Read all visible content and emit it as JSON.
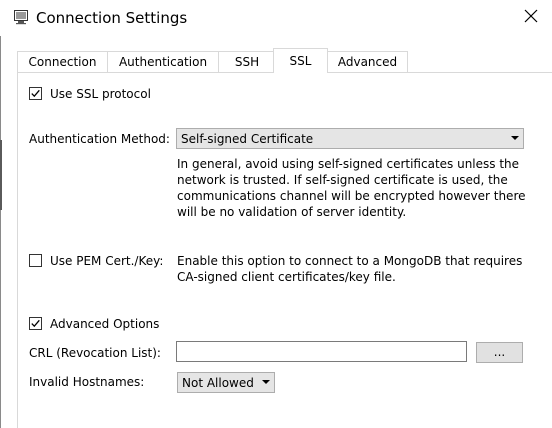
{
  "window": {
    "title": "Connection Settings"
  },
  "tabs": [
    {
      "label": "Connection"
    },
    {
      "label": "Authentication"
    },
    {
      "label": "SSH"
    },
    {
      "label": "SSL",
      "active": true
    },
    {
      "label": "Advanced"
    }
  ],
  "ssl": {
    "use_ssl": {
      "label": "Use SSL protocol",
      "checked": true
    },
    "auth_method": {
      "label": "Authentication Method:",
      "selected": "Self-signed Certificate",
      "description": "In general, avoid using self-signed certificates unless the network is trusted. If self-signed certificate is used, the communications channel will be encrypted however there will be no validation of server identity."
    },
    "use_pem": {
      "label": "Use PEM Cert./Key:",
      "checked": false,
      "description": "Enable this option to connect to a MongoDB that requires CA-signed client certificates/key file."
    },
    "advanced_options": {
      "label": "Advanced Options",
      "checked": true
    },
    "crl": {
      "label": "CRL (Revocation List):",
      "value": "",
      "browse_label": "..."
    },
    "invalid_hostnames": {
      "label": "Invalid Hostnames:",
      "selected": "Not Allowed"
    }
  },
  "colors": {
    "tab_border": "#d9d9d9",
    "combo_bg": "#e5e5e5",
    "button_bg": "#e1e1e1"
  },
  "icons": {
    "app": "app-window-icon",
    "close": "close-icon",
    "check": "checkmark-icon",
    "dropdown": "chevron-down-icon"
  }
}
